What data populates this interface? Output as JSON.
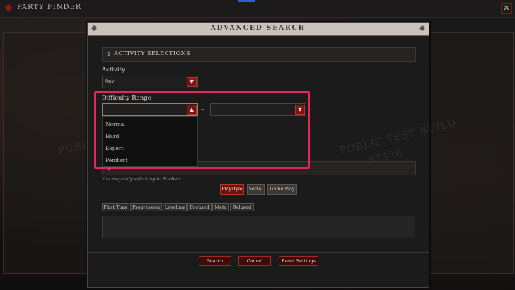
{
  "window": {
    "title": "PARTY FINDER",
    "close_glyph": "✕"
  },
  "dialog": {
    "title": "ADVANCED SEARCH",
    "activity_section": {
      "title": "ACTIVITY SELECTIONS",
      "activity_label": "Activity",
      "activity_value": "Any",
      "difficulty_label": "Difficulty Range",
      "difficulty_from_value": "",
      "difficulty_to_value": "",
      "range_separator": "–",
      "difficulty_options": [
        "Normal",
        "Hard",
        "Expert",
        "Penitent"
      ]
    },
    "label_section": {
      "title": "LABEL SELECTIONS",
      "hint": "You may only select up to 8 labels.",
      "tabs": [
        "Playstyle",
        "Social",
        "Game Play"
      ],
      "active_tab": "Playstyle",
      "chips": [
        "First Time",
        "Progression",
        "Leveling",
        "Focused",
        "Meta",
        "Relaxed"
      ]
    },
    "buttons": {
      "search": "Search",
      "cancel": "Cancel",
      "reset": "Reset Settings"
    }
  },
  "watermarks": {
    "line1": "PUBLIC TEST BUILD",
    "line2": "57456"
  },
  "icons": {
    "dropdown_open": "▲",
    "dropdown_closed": "▼",
    "section_marker": "✣"
  },
  "colors": {
    "accent_red": "#7c1410",
    "highlight": "#e7245b",
    "header_bg": "#c9c3bc"
  }
}
